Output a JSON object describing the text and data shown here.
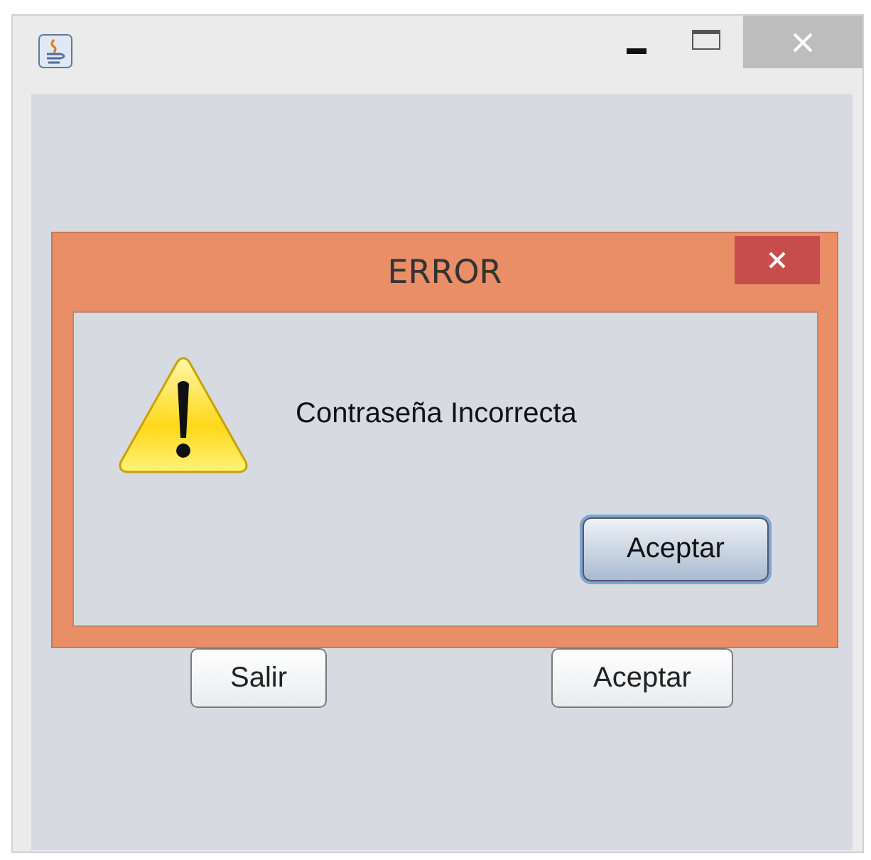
{
  "window": {
    "buttons": [
      {
        "label": "Salir"
      },
      {
        "label": "Aceptar"
      }
    ]
  },
  "dialog": {
    "title": "ERROR",
    "message": "Contraseña Incorrecta",
    "button": {
      "label": "Aceptar",
      "focused": true
    }
  }
}
